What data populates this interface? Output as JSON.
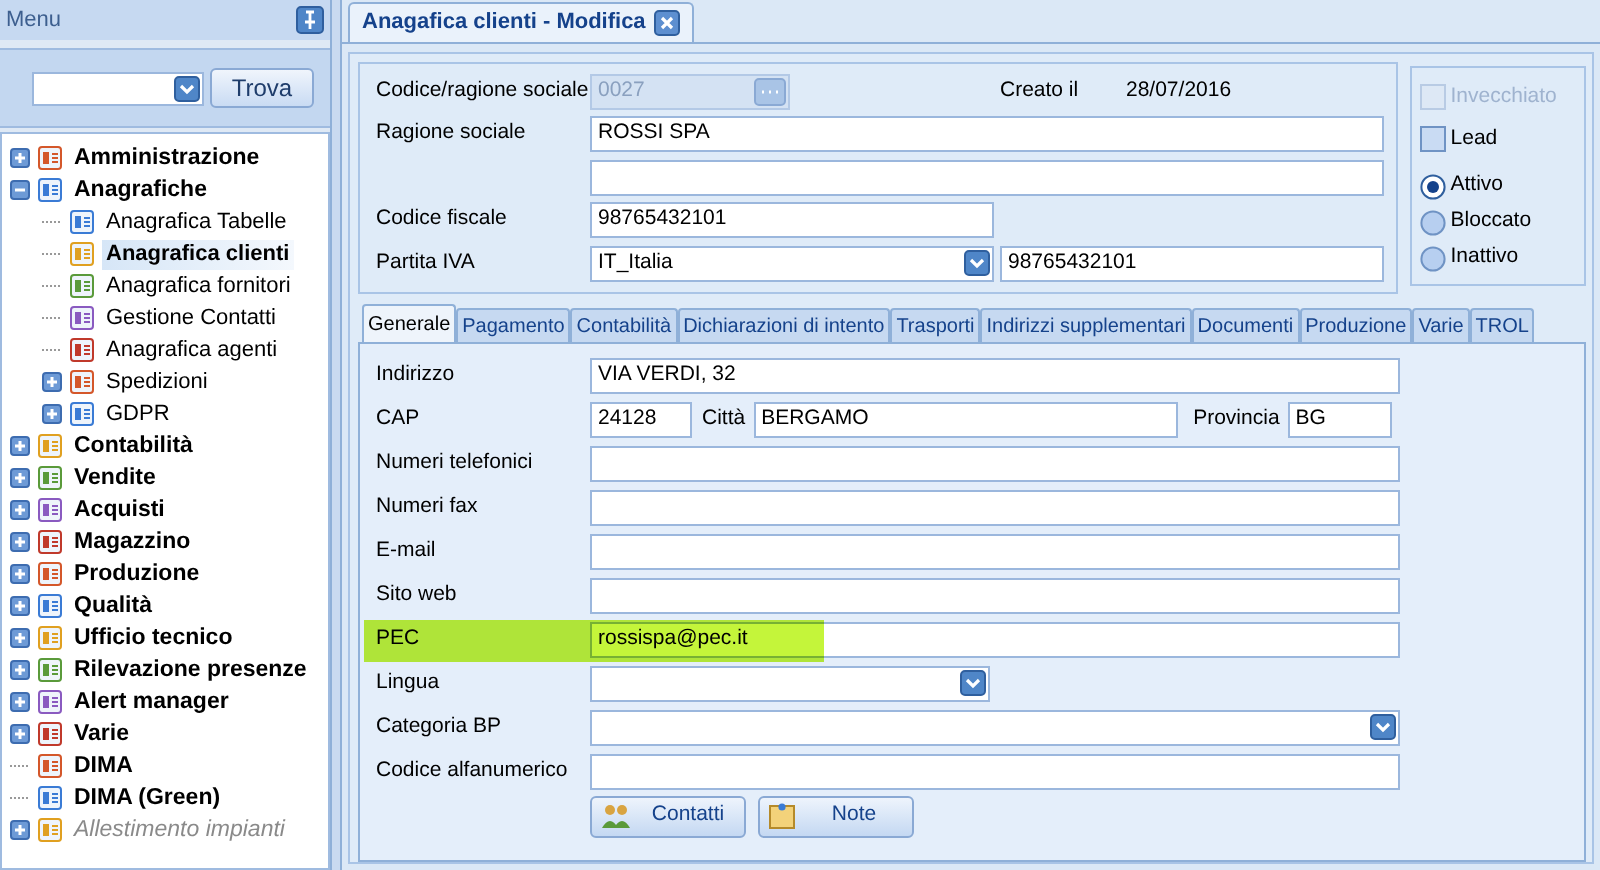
{
  "sidebar": {
    "title": "Menu",
    "search": {
      "button": "Trova"
    },
    "tree": [
      {
        "label": "Amministrazione",
        "kind": "group",
        "expanded": false,
        "selected": false,
        "disabled": false
      },
      {
        "label": "Anagrafiche",
        "kind": "group",
        "expanded": true,
        "selected": false,
        "disabled": false,
        "children": [
          {
            "label": "Anagrafica Tabelle",
            "kind": "leaf",
            "selected": false,
            "disabled": false
          },
          {
            "label": "Anagrafica clienti",
            "kind": "leaf",
            "selected": true,
            "disabled": false
          },
          {
            "label": "Anagrafica fornitori",
            "kind": "leaf",
            "selected": false,
            "disabled": false
          },
          {
            "label": "Gestione Contatti",
            "kind": "leaf",
            "selected": false,
            "disabled": false
          },
          {
            "label": "Anagrafica agenti",
            "kind": "leaf",
            "selected": false,
            "disabled": false
          },
          {
            "label": "Spedizioni",
            "kind": "group",
            "expanded": false,
            "selected": false,
            "disabled": false
          },
          {
            "label": "GDPR",
            "kind": "group",
            "expanded": false,
            "selected": false,
            "disabled": false
          }
        ]
      },
      {
        "label": "Contabilità",
        "kind": "group",
        "expanded": false,
        "selected": false,
        "disabled": false
      },
      {
        "label": "Vendite",
        "kind": "group",
        "expanded": false,
        "selected": false,
        "disabled": false
      },
      {
        "label": "Acquisti",
        "kind": "group",
        "expanded": false,
        "selected": false,
        "disabled": false
      },
      {
        "label": "Magazzino",
        "kind": "group",
        "expanded": false,
        "selected": false,
        "disabled": false
      },
      {
        "label": "Produzione",
        "kind": "group",
        "expanded": false,
        "selected": false,
        "disabled": false
      },
      {
        "label": "Qualità",
        "kind": "group",
        "expanded": false,
        "selected": false,
        "disabled": false
      },
      {
        "label": "Ufficio tecnico",
        "kind": "group",
        "expanded": false,
        "selected": false,
        "disabled": false
      },
      {
        "label": "Rilevazione presenze",
        "kind": "group",
        "expanded": false,
        "selected": false,
        "disabled": false
      },
      {
        "label": "Alert manager",
        "kind": "group",
        "expanded": false,
        "selected": false,
        "disabled": false
      },
      {
        "label": "Varie",
        "kind": "group",
        "expanded": false,
        "selected": false,
        "disabled": false
      },
      {
        "label": "DIMA",
        "kind": "leaf",
        "selected": false,
        "disabled": false
      },
      {
        "label": "DIMA (Green)",
        "kind": "leaf",
        "selected": false,
        "disabled": false
      },
      {
        "label": "Allestimento impianti",
        "kind": "group",
        "expanded": false,
        "selected": false,
        "disabled": true
      }
    ]
  },
  "document_tab": {
    "label": "Anagafica clienti - Modifica",
    "selected": true
  },
  "header_form": {
    "rows": [
      {
        "kind": "lookup",
        "label": "Codice/ragione sociale",
        "value": "0027",
        "disabled": true,
        "created_label": "Creato il",
        "created_date": "28/07/2016"
      },
      {
        "kind": "text",
        "label": "Ragione sociale",
        "value": "ROSSI SPA",
        "disabled": false
      },
      {
        "kind": "text",
        "disabled": false
      },
      {
        "kind": "text_short",
        "label": "Codice fiscale",
        "value": "98765432101",
        "disabled": false
      },
      {
        "kind": "country_vat",
        "label": "Partita IVA",
        "country": "IT_Italia",
        "value": "98765432101",
        "disabled": false
      }
    ]
  },
  "status_box": {
    "checkboxes": [
      {
        "label": "Invecchiato",
        "checked": false,
        "disabled": true
      },
      {
        "label": "Lead",
        "checked": false,
        "disabled": false
      }
    ],
    "radios": [
      {
        "label": "Attivo",
        "selected": true
      },
      {
        "label": "Bloccato",
        "selected": false
      },
      {
        "label": "Inattivo",
        "selected": false
      }
    ]
  },
  "section_tabs": [
    {
      "label": "Generale",
      "selected": true
    },
    {
      "label": "Pagamento",
      "selected": false
    },
    {
      "label": "Contabilità",
      "selected": false
    },
    {
      "label": "Dichiarazioni di intento",
      "selected": false
    },
    {
      "label": "Trasporti",
      "selected": false
    },
    {
      "label": "Indirizzi supplementari",
      "selected": false
    },
    {
      "label": "Documenti",
      "selected": false
    },
    {
      "label": "Produzione",
      "selected": false
    },
    {
      "label": "Varie",
      "selected": false
    },
    {
      "label": "TROL",
      "selected": false
    }
  ],
  "general_fields": [
    {
      "kind": "text",
      "label": "Indirizzo",
      "value": "VIA VERDI, 32",
      "highlighted": false
    },
    {
      "kind": "address",
      "label": "CAP",
      "value": "24128",
      "city_label": "Città",
      "city": "BERGAMO",
      "province_label": "Provincia",
      "province": "BG",
      "highlighted": false
    },
    {
      "kind": "text",
      "label": "Numeri telefonici",
      "highlighted": false
    },
    {
      "kind": "text",
      "label": "Numeri fax",
      "highlighted": false
    },
    {
      "kind": "text",
      "label": "E-mail",
      "highlighted": false
    },
    {
      "kind": "text",
      "label": "Sito web",
      "highlighted": false
    },
    {
      "kind": "text",
      "label": "PEC",
      "value": "rossispa@pec.it",
      "highlighted": true
    },
    {
      "kind": "combo_short",
      "label": "Lingua",
      "highlighted": false
    },
    {
      "kind": "combo",
      "label": "Categoria BP",
      "highlighted": false
    },
    {
      "kind": "text",
      "label": "Codice alfanumerico",
      "highlighted": false
    }
  ],
  "buttons": [
    {
      "label": "Contatti",
      "kind": "contacts"
    },
    {
      "label": "Note",
      "kind": "note"
    }
  ]
}
